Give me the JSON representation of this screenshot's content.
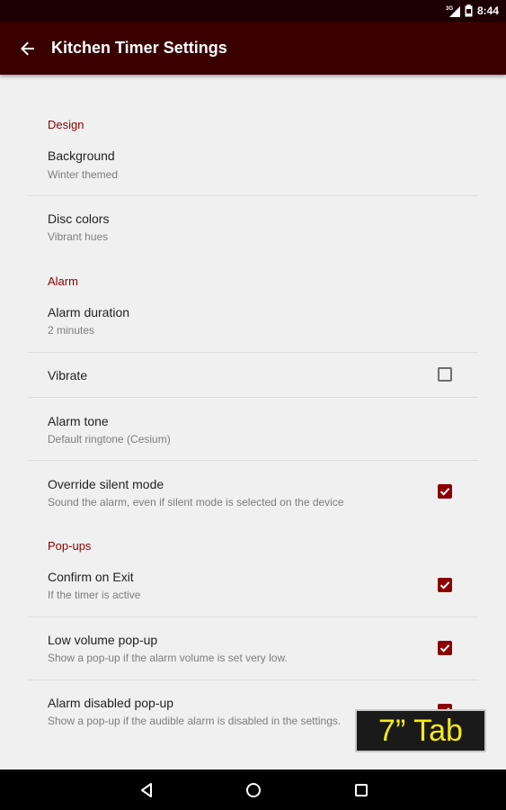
{
  "status_bar": {
    "network": "3G",
    "time": "8:44"
  },
  "app_bar": {
    "title": "Kitchen Timer Settings"
  },
  "sections": {
    "design": {
      "header": "Design",
      "background": {
        "title": "Background",
        "summary": "Winter themed"
      },
      "disc_colors": {
        "title": "Disc colors",
        "summary": "Vibrant hues"
      }
    },
    "alarm": {
      "header": "Alarm",
      "alarm_duration": {
        "title": "Alarm duration",
        "summary": "2 minutes"
      },
      "vibrate": {
        "title": "Vibrate",
        "checked": false
      },
      "alarm_tone": {
        "title": "Alarm tone",
        "summary": "Default ringtone (Cesium)"
      },
      "override_silent": {
        "title": "Override silent mode",
        "summary": "Sound the alarm, even if silent mode is selected on the device",
        "checked": true
      }
    },
    "popups": {
      "header": "Pop-ups",
      "confirm_exit": {
        "title": "Confirm on Exit",
        "summary": "If the timer is active",
        "checked": true
      },
      "low_volume": {
        "title": "Low volume pop-up",
        "summary": "Show a pop-up if the alarm volume is set very low.",
        "checked": true
      },
      "alarm_disabled": {
        "title": "Alarm disabled pop-up",
        "summary": "Show a pop-up if the audible alarm is disabled in the settings.",
        "checked": true
      }
    }
  },
  "overlay_badge": {
    "text": "7” Tab"
  },
  "colors": {
    "status_bar": "#1d0000",
    "app_bar": "#3a0000",
    "accent": "#8b0000",
    "background": "#f0f0f0",
    "badge_text": "#f3ec18"
  },
  "icons": {
    "back": "arrow-left-icon",
    "vibrate_checkbox": "checkbox-empty-icon",
    "checked_checkbox": "checkbox-checked-icon",
    "nav_back": "triangle-back-icon",
    "nav_home": "circle-home-icon",
    "nav_recents": "square-recents-icon"
  }
}
